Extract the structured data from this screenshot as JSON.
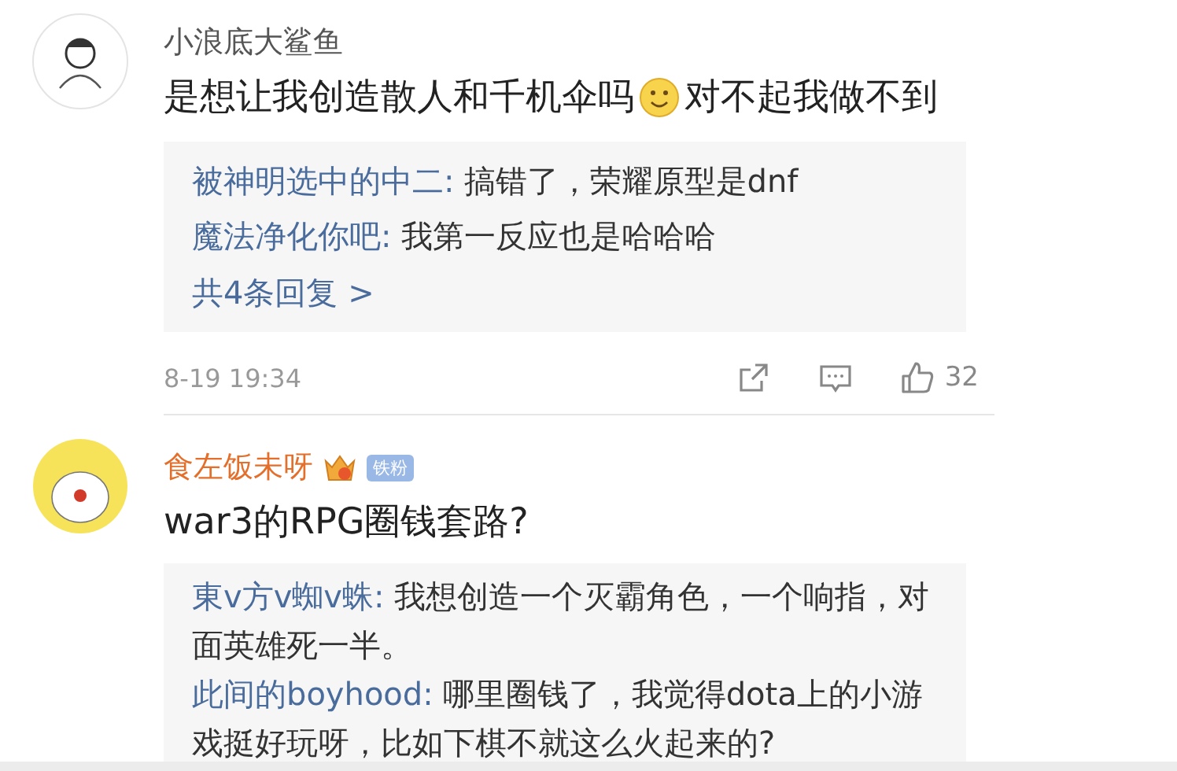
{
  "comments": [
    {
      "user": {
        "name": "小浪底大鲨鱼",
        "vip": false,
        "avatar": {
          "kind": "sketch"
        }
      },
      "content": [
        {
          "kind": "text",
          "text": "是想让我创造散人和千机伞吗"
        },
        {
          "kind": "emoji"
        },
        {
          "kind": "text",
          "text": "对不起我做不到"
        }
      ],
      "replies": [
        {
          "user": "被神明选中的中二:",
          "text": "搞错了，荣耀原型是dnf"
        },
        {
          "user": "魔法净化你吧:",
          "text": "我第一反应也是哈哈哈"
        }
      ],
      "more_replies": "共4条回复 >",
      "time": "8-19 19:34",
      "likes": "32"
    },
    {
      "user": {
        "name": "食左饭未呀",
        "vip": true,
        "badge": "铁粉",
        "avatar": {
          "kind": "blob"
        }
      },
      "content": [
        {
          "kind": "text",
          "text": "war3的RPG圈钱套路?"
        }
      ],
      "replies": [
        {
          "user": "東v方v蜘v蛛:",
          "text": "我想创造一个灭霸角色，一个响指，对面英雄死一半。"
        },
        {
          "user": "此间的boyhood:",
          "text": "哪里圈钱了，我觉得dota上的小游戏挺好玩呀，比如下棋不就这么火起来的?"
        }
      ]
    }
  ]
}
